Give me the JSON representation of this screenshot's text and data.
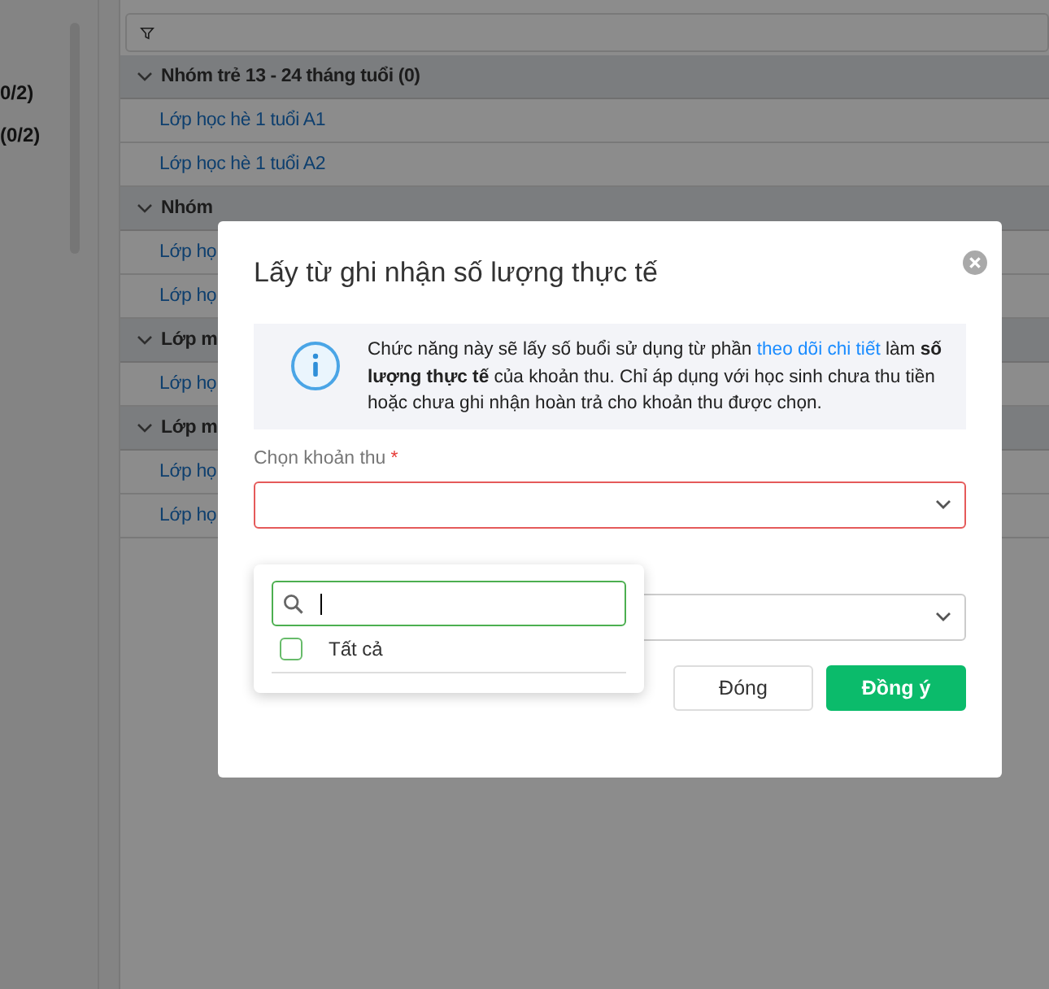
{
  "sidebar": {
    "counts": [
      "0/2)",
      "(0/2)"
    ]
  },
  "groups": [
    {
      "title": "Nhóm trẻ 13 - 24 tháng tuổi (0)",
      "expanded": true,
      "rows": [
        "Lớp học hè 1 tuổi A1",
        "Lớp học hè 1 tuổi A2"
      ]
    },
    {
      "title": "Nhóm",
      "expanded": true,
      "rows": [
        "Lớp họ",
        "Lớp họ"
      ]
    },
    {
      "title": "Lớp m",
      "expanded": true,
      "rows": [
        "Lớp họ"
      ]
    },
    {
      "title": "Lớp m",
      "expanded": true,
      "rows": [
        "Lớp họ",
        "Lớp họ"
      ]
    }
  ],
  "dialog": {
    "title": "Lấy từ ghi nhận số lượng thực tế",
    "info": {
      "before": "Chức năng này sẽ lấy số buổi sử dụng từ phần",
      "link": "theo dõi chi tiết",
      "after": "làm **số lượng thực tế** của khoản thu. Chỉ áp dụng với học sinh chưa thu tiền hoặc chưa ghi nhận hoàn trả cho khoản thu được chọn."
    },
    "fields": [
      {
        "label": "Chọn khoản thu",
        "required_mark": "*",
        "invalid": true
      },
      {
        "invalid": false
      }
    ],
    "dropdown": {
      "options": [
        {
          "label": "Tất cả",
          "checked": false
        }
      ]
    },
    "buttons": [
      {
        "label": "Đóng",
        "kind": "secondary"
      },
      {
        "label": "Đồng ý",
        "kind": "primary"
      }
    ]
  }
}
